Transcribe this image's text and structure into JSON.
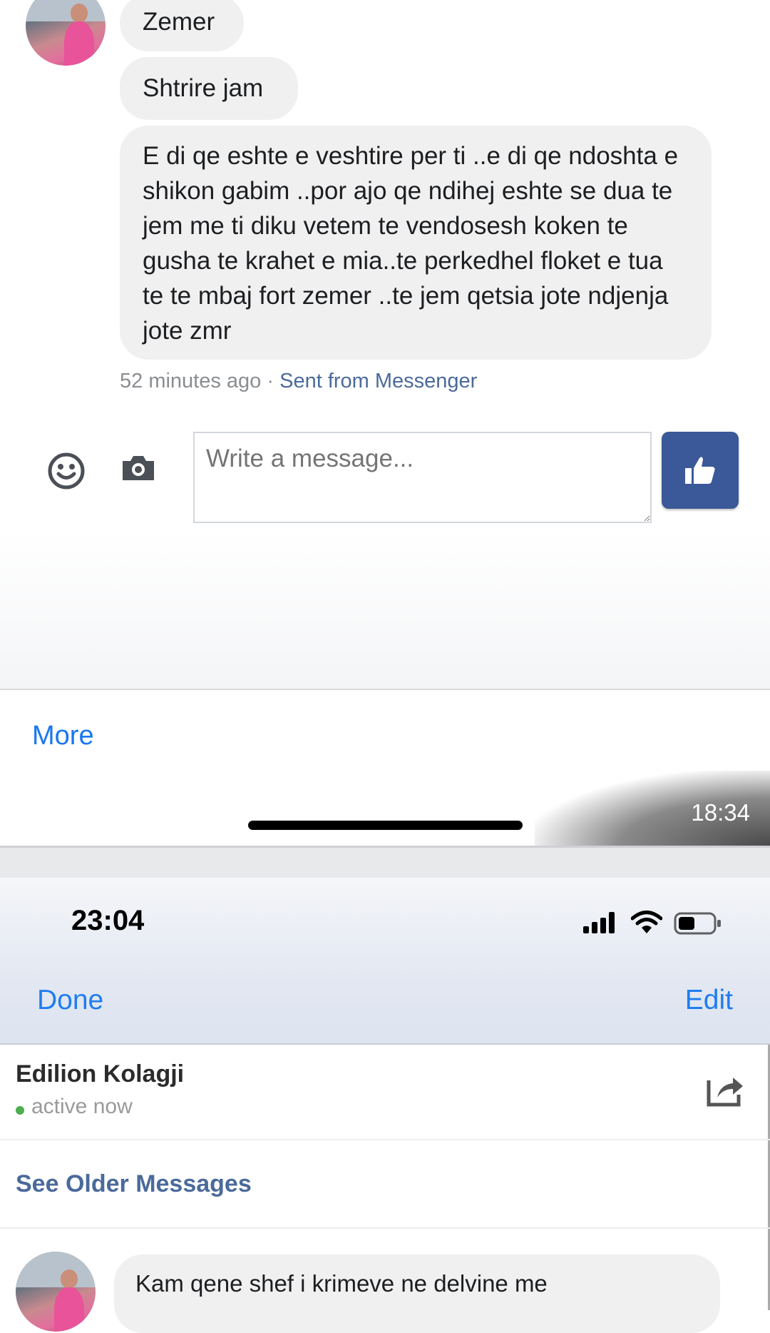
{
  "messages": [
    {
      "text": "Zemer"
    },
    {
      "text": "Shtrire jam"
    },
    {
      "text": "E di qe eshte e veshtire per ti ..e di qe ndoshta e shikon gabim ..por ajo qe ndihej eshte se dua te jem me ti diku vetem te vendosesh koken te gusha te krahet e mia..te perkedhel floket e tua te te mbaj fort zemer ..te jem qetsia jote ndjenja jote zmr"
    }
  ],
  "meta": {
    "time_ago": "52 minutes ago",
    "separator": "·",
    "sent_from": "Sent from Messenger"
  },
  "composer": {
    "placeholder": "Write a message...",
    "emoji_icon": "smiley-icon",
    "camera_icon": "camera-icon",
    "like_icon": "thumbs-up-icon"
  },
  "more_label": "More",
  "status_time_small": "18:34",
  "ios": {
    "time": "23:04",
    "done_label": "Done",
    "edit_label": "Edit"
  },
  "contact": {
    "name": "Edilion Kolagji",
    "status": "active now",
    "status_color": "#4cae4f"
  },
  "see_older_label": "See Older Messages",
  "older_message_preview": "Kam qene shef i krimeve ne delvine me",
  "colors": {
    "facebook_blue": "#3b5998",
    "ios_blue": "#1f7df0",
    "bubble_gray": "#f0f0f0",
    "link_gray_blue": "#4b6a9b"
  }
}
